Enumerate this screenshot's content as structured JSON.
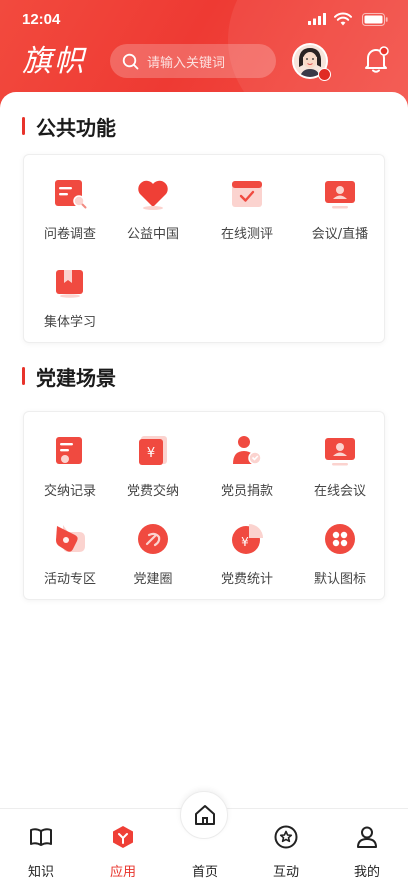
{
  "status_bar": {
    "time": "12:04"
  },
  "header": {
    "logo": "旗帜",
    "search_placeholder": "请输入关键词"
  },
  "sections": [
    {
      "title": "公共功能",
      "items": [
        {
          "label": "问卷调查",
          "icon": "survey-icon"
        },
        {
          "label": "公益中国",
          "icon": "heart-icon"
        },
        {
          "label": "在线测评",
          "icon": "evaluation-icon"
        },
        {
          "label": "会议/直播",
          "icon": "meeting-live-icon"
        },
        {
          "label": "集体学习",
          "icon": "study-icon"
        }
      ]
    },
    {
      "title": "党建场景",
      "items": [
        {
          "label": "交纳记录",
          "icon": "payment-record-icon"
        },
        {
          "label": "党费交纳",
          "icon": "party-fee-icon"
        },
        {
          "label": "党员捐款",
          "icon": "donation-icon"
        },
        {
          "label": "在线会议",
          "icon": "online-meeting-icon"
        },
        {
          "label": "活动专区",
          "icon": "activity-icon"
        },
        {
          "label": "党建圈",
          "icon": "party-circle-icon"
        },
        {
          "label": "党费统计",
          "icon": "fee-statistics-icon"
        },
        {
          "label": "默认图标",
          "icon": "default-grid-icon"
        }
      ]
    }
  ],
  "tabbar": {
    "items": [
      {
        "label": "知识",
        "icon": "book-icon"
      },
      {
        "label": "应用",
        "icon": "app-cube-icon"
      },
      {
        "label": "首页",
        "icon": "home-icon"
      },
      {
        "label": "互动",
        "icon": "star-circle-icon"
      },
      {
        "label": "我的",
        "icon": "user-icon"
      }
    ],
    "active": "应用"
  },
  "colors": {
    "brand_red": "#e8332b",
    "header_red": "#f04138"
  }
}
